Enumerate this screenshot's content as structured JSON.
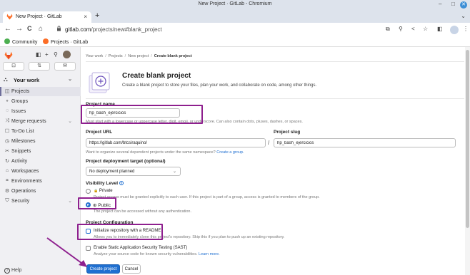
{
  "window": {
    "title": "New Project · GitLab - Chromium",
    "controls": [
      "–",
      "□"
    ],
    "close_glyph": "✕"
  },
  "tab": {
    "title": "New Project · GitLab",
    "close_glyph": "×",
    "new_tab_glyph": "+",
    "menu_glyph": "⌄"
  },
  "toolbar": {
    "back": "←",
    "forward": "→",
    "reload": "C",
    "home": "⌂",
    "url_host": "gitlab.com",
    "url_path": "/projects/new#blank_project",
    "icons": [
      "⧉",
      "⚲",
      "<",
      "☆",
      "◧",
      "⋮"
    ]
  },
  "bookmarks": [
    {
      "label": "Community",
      "color": "#4caf50"
    },
    {
      "label": "Projects · GitLab",
      "color": "#fc6d26"
    }
  ],
  "sidebar": {
    "top_icons": [
      "◧",
      "+",
      "⚲"
    ],
    "counters": [
      "⊡",
      "⇅",
      "✉"
    ],
    "section": {
      "icon": "⛬",
      "label": "Your work",
      "chevron": "⌄"
    },
    "items": [
      {
        "icon": "◫",
        "label": "Projects",
        "active": true
      },
      {
        "icon": "⚬",
        "label": "Groups"
      },
      {
        "icon": "◌",
        "label": "Issues"
      },
      {
        "icon": "⤨",
        "label": "Merge requests",
        "chevron": "⌄"
      },
      {
        "icon": "☐",
        "label": "To-Do List"
      },
      {
        "icon": "◷",
        "label": "Milestones"
      },
      {
        "icon": "✂",
        "label": "Snippets"
      },
      {
        "icon": "↻",
        "label": "Activity"
      },
      {
        "icon": "⌂",
        "label": "Workspaces"
      },
      {
        "icon": "⌗",
        "label": "Environments"
      },
      {
        "icon": "⚙",
        "label": "Operations"
      },
      {
        "icon": "⛉",
        "label": "Security",
        "chevron": "⌄"
      }
    ],
    "help": "Help",
    "help_icon": "?"
  },
  "breadcrumb": [
    "Your work",
    "Projects",
    "New project",
    "Create blank project"
  ],
  "breadcrumb_sep": "/",
  "page": {
    "title": "Create blank project",
    "description": "Create a blank project to store your files, plan your work, and collaborate on code, among other things."
  },
  "form": {
    "project_name_label": "Project name",
    "project_name_value": "hp_bash_ejercicios",
    "project_name_help": "Must start with a lowercase or uppercase letter, digit, emoji, or underscore. Can also contain dots, pluses, dashes, or spaces.",
    "project_url_label": "Project URL",
    "project_url_value": "https://gitlab.com/btcsiraquino/",
    "slash": "/",
    "project_slug_label": "Project slug",
    "project_slug_value": "hp_bash_ejercicios",
    "namespace_help": "Want to organize several dependent projects under the same namespace?",
    "namespace_link": "Create a group.",
    "deployment_label": "Project deployment target (optional)",
    "deployment_value": "No deployment planned",
    "caret": "⌄",
    "visibility_label": "Visibility Level",
    "visibility_info": "?",
    "private_label": "Private",
    "private_help": "Project access must be granted explicitly to each user. If this project is part of a group, access is granted to members of the group.",
    "public_label": "Public",
    "public_help": "The project can be accessed without any authentication.",
    "lock_glyph": "🔒",
    "globe_glyph": "⊕",
    "config_label": "Project Configuration",
    "readme_label": "Initialize repository with a README",
    "readme_help": "Allows you to immediately clone this project's repository. Skip this if you plan to push up an existing repository.",
    "sast_label": "Enable Static Application Security Testing (SAST)",
    "sast_help": "Analyze your source code for known security vulnerabilities.",
    "sast_link": "Learn more.",
    "create_button": "Create project",
    "cancel_button": "Cancel"
  },
  "colors": {
    "annotation": "#8e1f8e",
    "primary": "#1f6fd0",
    "gitlab_orange": "#fc6d26"
  }
}
